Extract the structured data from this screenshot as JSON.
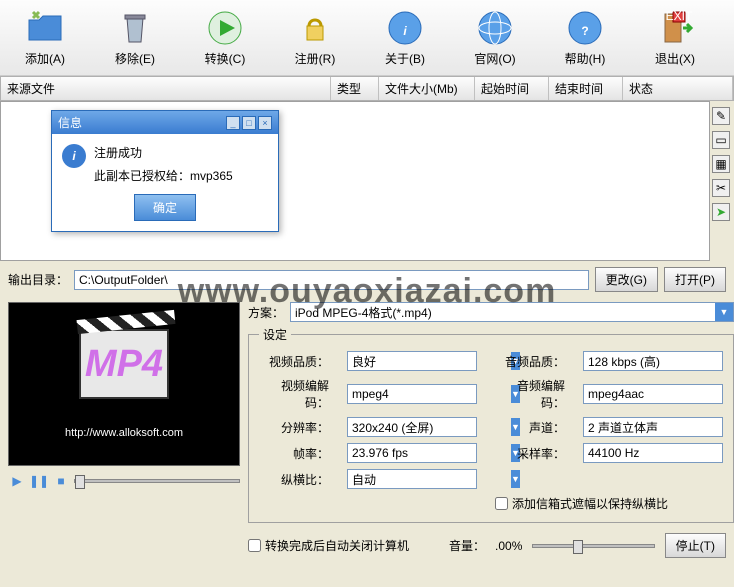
{
  "toolbar": [
    {
      "name": "add-button",
      "label": "添加(A)",
      "icon": "folder"
    },
    {
      "name": "remove-button",
      "label": "移除(E)",
      "icon": "trash"
    },
    {
      "name": "convert-button",
      "label": "转换(C)",
      "icon": "play"
    },
    {
      "name": "register-button",
      "label": "注册(R)",
      "icon": "lock"
    },
    {
      "name": "about-button",
      "label": "关于(B)",
      "icon": "info"
    },
    {
      "name": "website-button",
      "label": "官网(O)",
      "icon": "globe"
    },
    {
      "name": "help-button",
      "label": "帮助(H)",
      "icon": "help"
    },
    {
      "name": "exit-button",
      "label": "退出(X)",
      "icon": "exit"
    }
  ],
  "columns": {
    "source": "来源文件",
    "type": "类型",
    "size": "文件大小(Mb)",
    "start": "起始时间",
    "end": "结束时间",
    "status": "状态"
  },
  "dialog": {
    "title": "信息",
    "line1": "注册成功",
    "line2": "此副本已授权给：mvp365",
    "ok": "确定"
  },
  "output": {
    "label": "输出目录：",
    "path": "C:\\OutputFolder\\",
    "change": "更改(G)",
    "open": "打开(P)"
  },
  "watermark": "www.ouyaoxiazai.com",
  "scheme": {
    "label": "方案：",
    "value": "iPod MPEG-4格式(*.mp4)"
  },
  "settings_legend": "设定",
  "settings": {
    "video_quality": {
      "label": "视频品质：",
      "value": "良好"
    },
    "audio_quality": {
      "label": "音频品质：",
      "value": "128 kbps (高)"
    },
    "video_codec": {
      "label": "视频编解码：",
      "value": "mpeg4"
    },
    "audio_codec": {
      "label": "音频编解码：",
      "value": "mpeg4aac"
    },
    "resolution": {
      "label": "分辨率：",
      "value": "320x240 (全屏)"
    },
    "channels": {
      "label": "声道：",
      "value": "2 声道立体声"
    },
    "fps": {
      "label": "帧率：",
      "value": "23.976 fps"
    },
    "sample_rate": {
      "label": "采样率：",
      "value": "44100 Hz"
    },
    "aspect": {
      "label": "纵横比：",
      "value": "自动"
    },
    "letterbox": "添加信箱式遮幅以保持纵横比"
  },
  "preview": {
    "mp4": "MP4",
    "url": "http://www.alloksoft.com"
  },
  "bottom": {
    "shutdown": "转换完成后自动关闭计算机",
    "volume_label": "音量：",
    "volume_value": ".00%",
    "stop": "停止(T)"
  }
}
